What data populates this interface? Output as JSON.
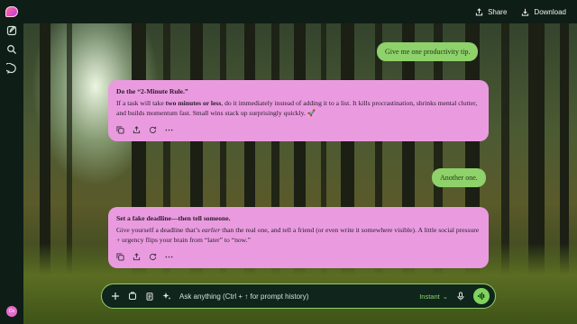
{
  "sidebar": {
    "items": [
      {
        "icon": "new-chat-icon"
      },
      {
        "icon": "search-icon"
      },
      {
        "icon": "chat-bubble-icon"
      }
    ],
    "avatar_initials": "Cn"
  },
  "header": {
    "share_label": "Share",
    "download_label": "Download"
  },
  "messages": [
    {
      "role": "user",
      "text": "Give me one productivity tip."
    },
    {
      "role": "assistant",
      "heading": "Do the “2-Minute Rule.”",
      "body_pre": "If a task will take ",
      "body_bold": "two minutes or less",
      "body_post": ", do it immediately instead of adding it to a list. It kills procrastination, shrinks mental clutter, and builds momentum fast. Small wins stack up surprisingly quickly. ",
      "emoji": "🚀"
    },
    {
      "role": "user",
      "text": "Another one."
    },
    {
      "role": "assistant",
      "heading": "Set a fake deadline—then tell someone.",
      "body_pre": "Give yourself a deadline that’s ",
      "body_italic": "earlier",
      "body_post": " than the real one, and tell a friend (or even write it somewhere visible). A little social pressure + urgency flips your brain from “later” to “now.”"
    }
  ],
  "composer": {
    "placeholder": "Ask anything (Ctrl + ↑ for prompt history)",
    "mode": "Instant",
    "mode_chevron": "⌄"
  },
  "colors": {
    "user_bubble": "#8fd16b",
    "assistant_bubble": "#ea9be0",
    "accent": "#7ed45c"
  }
}
